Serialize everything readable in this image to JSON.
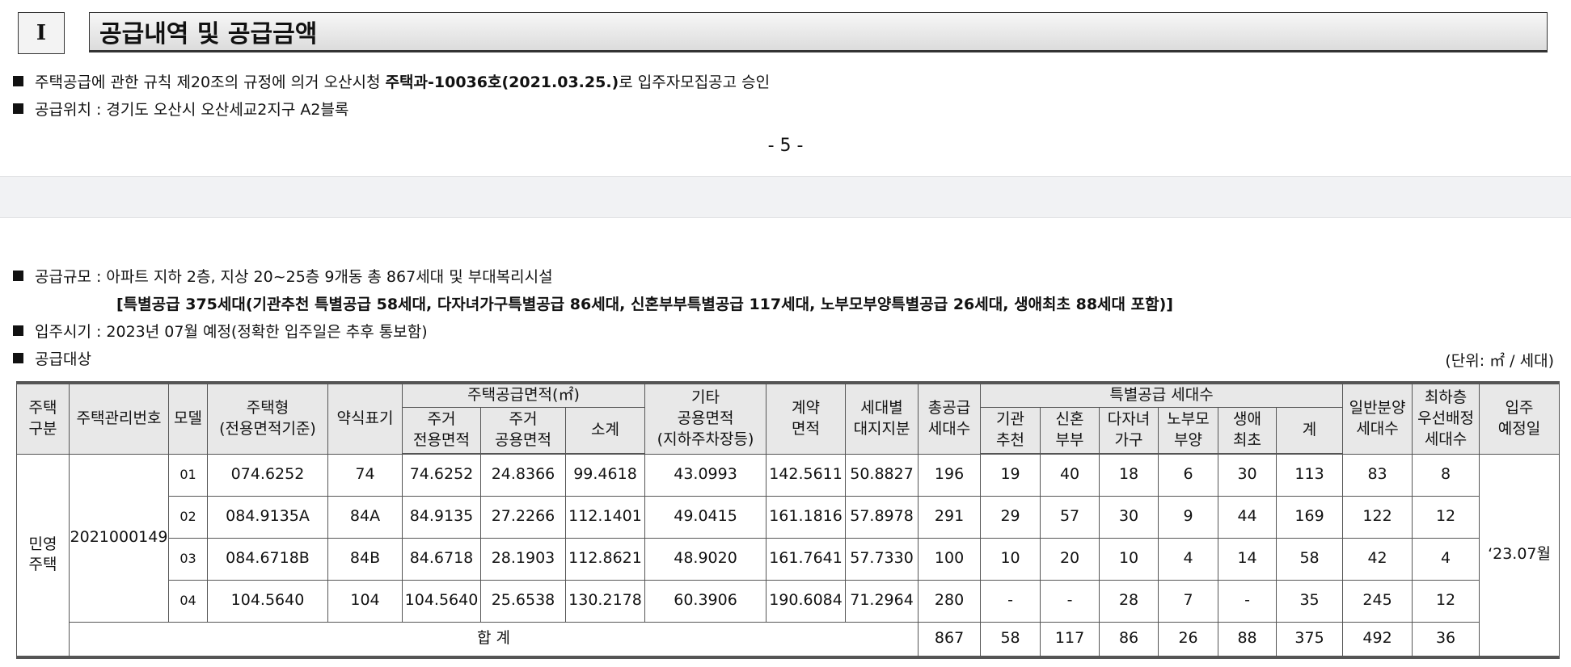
{
  "section": {
    "number": "I",
    "title": "공급내역 및 공급금액"
  },
  "bullets_top": [
    {
      "pre": "주택공급에 관한 규칙 제20조의 규정에 의거 오산시청 ",
      "bold": "주택과-10036호(2021.03.25.)",
      "post": "로 입주자모집공고 승인"
    },
    {
      "text": "공급위치 : 경기도 오산시 오산세교2지구 A2블록"
    }
  ],
  "page_number": "- 5 -",
  "bullets_bottom": {
    "scale": "공급규모 : 아파트 지하 2층, 지상 20~25층 9개동 총 867세대 및 부대복리시설",
    "scale_detail": "[특별공급 375세대(기관추천 특별공급 58세대, 다자녀가구특별공급 86세대, 신혼부부특별공급 117세대, 노부모부양특별공급 26세대, 생애최초 88세대 포함)]",
    "move_in": "입주시기 : 2023년 07월 예정(정확한 입주일은 추후 통보함)",
    "target": "공급대상"
  },
  "unit": "(단위: ㎡ / 세대)",
  "table": {
    "headers": {
      "type": "주택\n구분",
      "mgmt_no": "주택관리번호",
      "model": "모델",
      "housing_type": "주택형\n(전용면적기준)",
      "abbr": "약식표기",
      "area_group": "주택공급면적(㎡)",
      "exclusive": "주거\n전용면적",
      "shared": "주거\n공용면적",
      "subtotal": "소계",
      "other": "기타\n공용면적\n(지하주차장등)",
      "contract": "계약\n면적",
      "land": "세대별\n대지지분",
      "total_supply": "총공급\n세대수",
      "special_group": "특별공급 세대수",
      "inst": "기관\n추천",
      "newlywed": "신혼\n부부",
      "multichild": "다자녀\n가구",
      "elderly": "노부모\n부양",
      "first": "생애\n최초",
      "sum": "계",
      "general": "일반분양\n세대수",
      "lowest": "최하층\n우선배정\n세대수",
      "move_in": "입주\n예정일"
    },
    "type_value": "민영\n주택",
    "mgmt_value": "2021000149",
    "move_in_value": "‘23.07월",
    "rows": [
      {
        "model": "01",
        "housing_type": "074.6252",
        "abbr": "74",
        "exclusive": "74.6252",
        "shared": "24.8366",
        "subtotal": "99.4618",
        "other": "43.0993",
        "contract": "142.5611",
        "land": "50.8827",
        "total": "196",
        "inst": "19",
        "newlywed": "40",
        "multichild": "18",
        "elderly": "6",
        "first": "30",
        "sum": "113",
        "general": "83",
        "lowest": "8"
      },
      {
        "model": "02",
        "housing_type": "084.9135A",
        "abbr": "84A",
        "exclusive": "84.9135",
        "shared": "27.2266",
        "subtotal": "112.1401",
        "other": "49.0415",
        "contract": "161.1816",
        "land": "57.8978",
        "total": "291",
        "inst": "29",
        "newlywed": "57",
        "multichild": "30",
        "elderly": "9",
        "first": "44",
        "sum": "169",
        "general": "122",
        "lowest": "12"
      },
      {
        "model": "03",
        "housing_type": "084.6718B",
        "abbr": "84B",
        "exclusive": "84.6718",
        "shared": "28.1903",
        "subtotal": "112.8621",
        "other": "48.9020",
        "contract": "161.7641",
        "land": "57.7330",
        "total": "100",
        "inst": "10",
        "newlywed": "20",
        "multichild": "10",
        "elderly": "4",
        "first": "14",
        "sum": "58",
        "general": "42",
        "lowest": "4"
      },
      {
        "model": "04",
        "housing_type": "104.5640",
        "abbr": "104",
        "exclusive": "104.5640",
        "shared": "25.6538",
        "subtotal": "130.2178",
        "other": "60.3906",
        "contract": "190.6084",
        "land": "71.2964",
        "total": "280",
        "inst": "-",
        "newlywed": "-",
        "multichild": "28",
        "elderly": "7",
        "first": "-",
        "sum": "35",
        "general": "245",
        "lowest": "12"
      }
    ],
    "total_row": {
      "label": "합 계",
      "total": "867",
      "inst": "58",
      "newlywed": "117",
      "multichild": "86",
      "elderly": "26",
      "first": "88",
      "sum": "375",
      "general": "492",
      "lowest": "36"
    }
  }
}
